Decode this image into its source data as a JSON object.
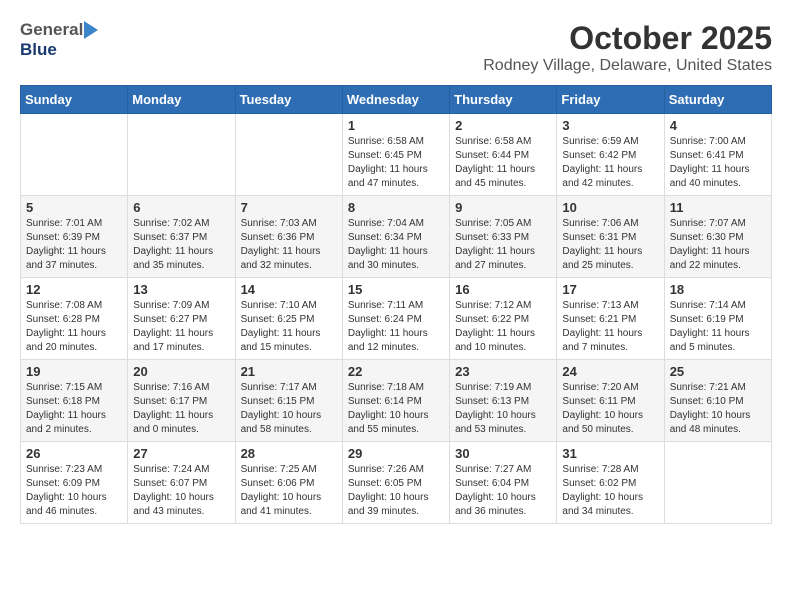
{
  "header": {
    "logo_general": "General",
    "logo_blue": "Blue",
    "month": "October 2025",
    "location": "Rodney Village, Delaware, United States"
  },
  "weekdays": [
    "Sunday",
    "Monday",
    "Tuesday",
    "Wednesday",
    "Thursday",
    "Friday",
    "Saturday"
  ],
  "weeks": [
    [
      {
        "day": "",
        "info": ""
      },
      {
        "day": "",
        "info": ""
      },
      {
        "day": "",
        "info": ""
      },
      {
        "day": "1",
        "info": "Sunrise: 6:58 AM\nSunset: 6:45 PM\nDaylight: 11 hours\nand 47 minutes."
      },
      {
        "day": "2",
        "info": "Sunrise: 6:58 AM\nSunset: 6:44 PM\nDaylight: 11 hours\nand 45 minutes."
      },
      {
        "day": "3",
        "info": "Sunrise: 6:59 AM\nSunset: 6:42 PM\nDaylight: 11 hours\nand 42 minutes."
      },
      {
        "day": "4",
        "info": "Sunrise: 7:00 AM\nSunset: 6:41 PM\nDaylight: 11 hours\nand 40 minutes."
      }
    ],
    [
      {
        "day": "5",
        "info": "Sunrise: 7:01 AM\nSunset: 6:39 PM\nDaylight: 11 hours\nand 37 minutes."
      },
      {
        "day": "6",
        "info": "Sunrise: 7:02 AM\nSunset: 6:37 PM\nDaylight: 11 hours\nand 35 minutes."
      },
      {
        "day": "7",
        "info": "Sunrise: 7:03 AM\nSunset: 6:36 PM\nDaylight: 11 hours\nand 32 minutes."
      },
      {
        "day": "8",
        "info": "Sunrise: 7:04 AM\nSunset: 6:34 PM\nDaylight: 11 hours\nand 30 minutes."
      },
      {
        "day": "9",
        "info": "Sunrise: 7:05 AM\nSunset: 6:33 PM\nDaylight: 11 hours\nand 27 minutes."
      },
      {
        "day": "10",
        "info": "Sunrise: 7:06 AM\nSunset: 6:31 PM\nDaylight: 11 hours\nand 25 minutes."
      },
      {
        "day": "11",
        "info": "Sunrise: 7:07 AM\nSunset: 6:30 PM\nDaylight: 11 hours\nand 22 minutes."
      }
    ],
    [
      {
        "day": "12",
        "info": "Sunrise: 7:08 AM\nSunset: 6:28 PM\nDaylight: 11 hours\nand 20 minutes."
      },
      {
        "day": "13",
        "info": "Sunrise: 7:09 AM\nSunset: 6:27 PM\nDaylight: 11 hours\nand 17 minutes."
      },
      {
        "day": "14",
        "info": "Sunrise: 7:10 AM\nSunset: 6:25 PM\nDaylight: 11 hours\nand 15 minutes."
      },
      {
        "day": "15",
        "info": "Sunrise: 7:11 AM\nSunset: 6:24 PM\nDaylight: 11 hours\nand 12 minutes."
      },
      {
        "day": "16",
        "info": "Sunrise: 7:12 AM\nSunset: 6:22 PM\nDaylight: 11 hours\nand 10 minutes."
      },
      {
        "day": "17",
        "info": "Sunrise: 7:13 AM\nSunset: 6:21 PM\nDaylight: 11 hours\nand 7 minutes."
      },
      {
        "day": "18",
        "info": "Sunrise: 7:14 AM\nSunset: 6:19 PM\nDaylight: 11 hours\nand 5 minutes."
      }
    ],
    [
      {
        "day": "19",
        "info": "Sunrise: 7:15 AM\nSunset: 6:18 PM\nDaylight: 11 hours\nand 2 minutes."
      },
      {
        "day": "20",
        "info": "Sunrise: 7:16 AM\nSunset: 6:17 PM\nDaylight: 11 hours\nand 0 minutes."
      },
      {
        "day": "21",
        "info": "Sunrise: 7:17 AM\nSunset: 6:15 PM\nDaylight: 10 hours\nand 58 minutes."
      },
      {
        "day": "22",
        "info": "Sunrise: 7:18 AM\nSunset: 6:14 PM\nDaylight: 10 hours\nand 55 minutes."
      },
      {
        "day": "23",
        "info": "Sunrise: 7:19 AM\nSunset: 6:13 PM\nDaylight: 10 hours\nand 53 minutes."
      },
      {
        "day": "24",
        "info": "Sunrise: 7:20 AM\nSunset: 6:11 PM\nDaylight: 10 hours\nand 50 minutes."
      },
      {
        "day": "25",
        "info": "Sunrise: 7:21 AM\nSunset: 6:10 PM\nDaylight: 10 hours\nand 48 minutes."
      }
    ],
    [
      {
        "day": "26",
        "info": "Sunrise: 7:23 AM\nSunset: 6:09 PM\nDaylight: 10 hours\nand 46 minutes."
      },
      {
        "day": "27",
        "info": "Sunrise: 7:24 AM\nSunset: 6:07 PM\nDaylight: 10 hours\nand 43 minutes."
      },
      {
        "day": "28",
        "info": "Sunrise: 7:25 AM\nSunset: 6:06 PM\nDaylight: 10 hours\nand 41 minutes."
      },
      {
        "day": "29",
        "info": "Sunrise: 7:26 AM\nSunset: 6:05 PM\nDaylight: 10 hours\nand 39 minutes."
      },
      {
        "day": "30",
        "info": "Sunrise: 7:27 AM\nSunset: 6:04 PM\nDaylight: 10 hours\nand 36 minutes."
      },
      {
        "day": "31",
        "info": "Sunrise: 7:28 AM\nSunset: 6:02 PM\nDaylight: 10 hours\nand 34 minutes."
      },
      {
        "day": "",
        "info": ""
      }
    ]
  ]
}
